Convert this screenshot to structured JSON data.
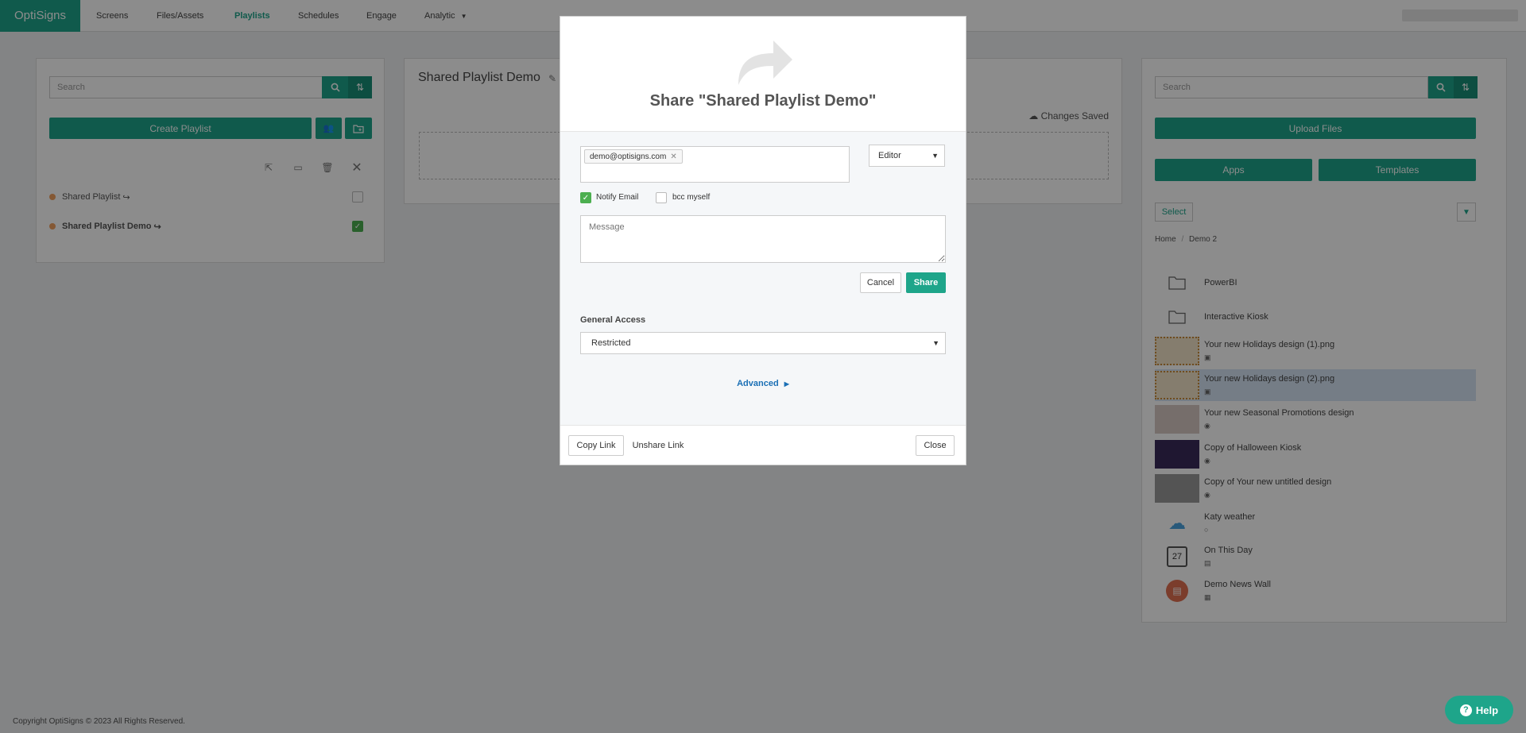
{
  "nav": {
    "brand": "OptiSigns",
    "items": [
      "Screens",
      "Files/Assets",
      "Playlists",
      "Schedules",
      "Engage",
      "Analytic"
    ],
    "active": "Playlists"
  },
  "left_panel": {
    "search_placeholder": "Search",
    "create_label": "Create Playlist",
    "playlists": [
      {
        "name": "Shared Playlist",
        "checked": false
      },
      {
        "name": "Shared Playlist Demo",
        "checked": true
      }
    ]
  },
  "center_panel": {
    "title": "Shared Playlist Demo",
    "status": "Changes Saved"
  },
  "right_panel": {
    "search_placeholder": "Search",
    "upload_label": "Upload Files",
    "apps_label": "Apps",
    "templates_label": "Templates",
    "select_label": "Select",
    "breadcrumb": [
      "Home",
      "Demo 2"
    ],
    "assets": [
      {
        "name": "PowerBI",
        "kind": "folder"
      },
      {
        "name": "Interactive Kiosk",
        "kind": "folder"
      },
      {
        "name": "Your new Holidays design (1).png",
        "kind": "image"
      },
      {
        "name": "Your new Holidays design (2).png",
        "kind": "image",
        "highlighted": true
      },
      {
        "name": "Your new Seasonal Promotions design",
        "kind": "design"
      },
      {
        "name": "Copy of Halloween Kiosk",
        "kind": "design"
      },
      {
        "name": "Copy of Your new untitled design",
        "kind": "design"
      },
      {
        "name": "Katy weather",
        "kind": "app"
      },
      {
        "name": "On This Day",
        "kind": "app",
        "badge": "27"
      },
      {
        "name": "Demo News Wall",
        "kind": "app"
      }
    ]
  },
  "modal": {
    "title": "Share \"Shared Playlist Demo\"",
    "email_tag": "demo@optisigns.com",
    "role": "Editor",
    "notify_label": "Notify Email",
    "notify_checked": true,
    "bcc_label": "bcc myself",
    "bcc_checked": false,
    "message_placeholder": "Message",
    "cancel_label": "Cancel",
    "share_label": "Share",
    "general_access_label": "General Access",
    "access_value": "Restricted",
    "advanced_label": "Advanced",
    "copy_link_label": "Copy Link",
    "unshare_link_label": "Unshare Link",
    "close_label": "Close"
  },
  "footer": {
    "copyright": "Copyright OptiSigns © 2023 All Rights Reserved.",
    "help_label": "Help"
  },
  "colors": {
    "accent": "#1ea58a",
    "checked": "#4caf50",
    "link": "#1a6fb5",
    "highlight": "#d6e4f5"
  }
}
